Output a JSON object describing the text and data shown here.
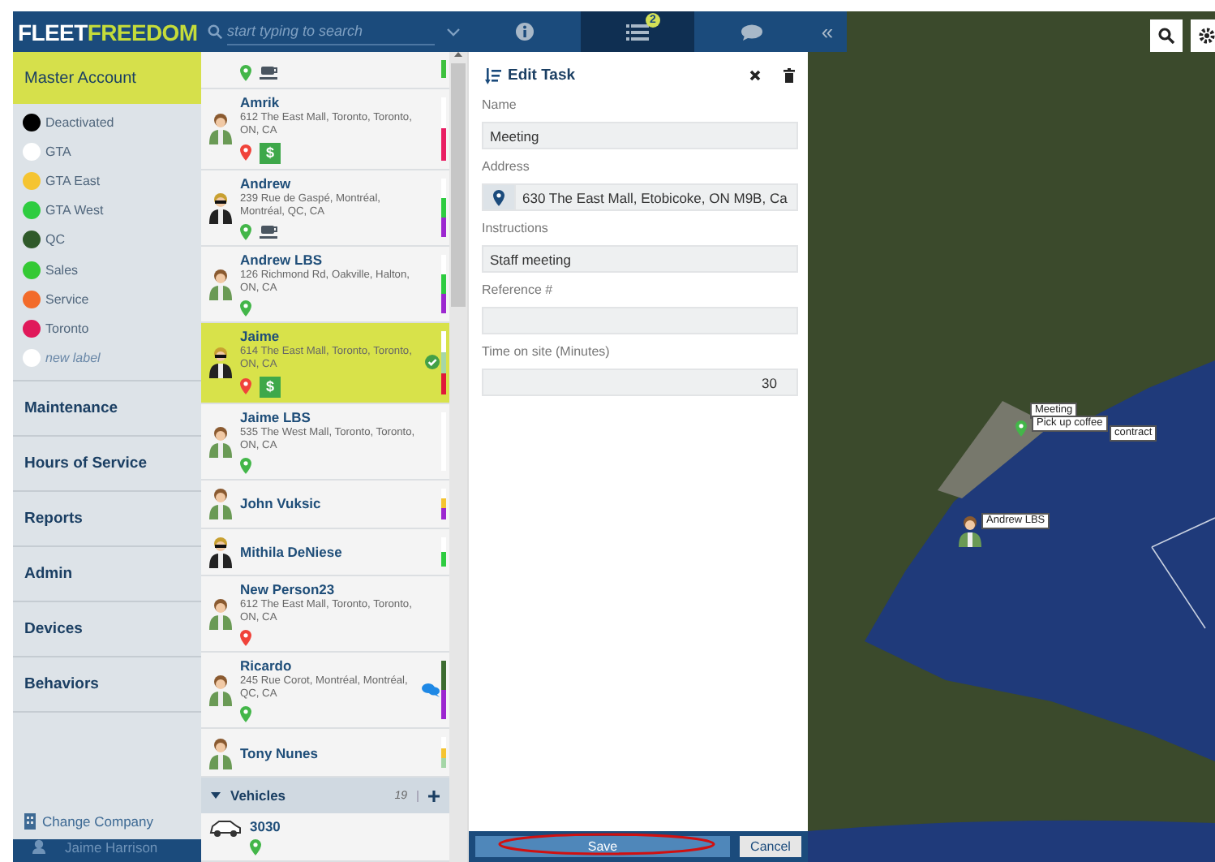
{
  "header": {
    "logo_parts": [
      "FLEET",
      "FREEDOM"
    ],
    "search": {
      "placeholder": "start typing to search"
    },
    "tabs": [
      {
        "kind": "info",
        "selected": false
      },
      {
        "kind": "tasks",
        "selected": true,
        "badge": "2"
      },
      {
        "kind": "chat",
        "selected": false
      }
    ],
    "collapse": "«"
  },
  "sidebar": {
    "account": {
      "label": "Master Account",
      "selected": true
    },
    "labels": [
      {
        "name": "Deactivated",
        "color": "#000000",
        "kind": "label"
      },
      {
        "name": "GTA",
        "color": "#ffffff",
        "kind": "label"
      },
      {
        "name": "GTA East",
        "color": "#f5c431",
        "kind": "label"
      },
      {
        "name": "GTA West",
        "color": "#2ecc40",
        "kind": "label"
      },
      {
        "name": "QC",
        "color": "#2f5a2a",
        "kind": "label"
      },
      {
        "name": "Sales",
        "color": "#34c934",
        "kind": "label"
      },
      {
        "name": "Service",
        "color": "#f26b2a",
        "kind": "label"
      },
      {
        "name": "Toronto",
        "color": "#e0195a",
        "kind": "label"
      },
      {
        "name": "new label",
        "color": "#ffffff",
        "kind": "new"
      }
    ],
    "menu": [
      "Maintenance",
      "Hours of Service",
      "Reports",
      "Admin",
      "Devices",
      "Behaviors"
    ],
    "change_company": "Change Company",
    "user": "Jaime Harrison"
  },
  "people": [
    {
      "kind": "partial",
      "pin": {
        "color": "#43b649"
      },
      "cup": true,
      "selected": false,
      "done": false,
      "chat": false,
      "tags": [
        {
          "color": "#3ec13e"
        }
      ]
    },
    {
      "kind": "person",
      "name": "Amrik",
      "address": "612 The East Mall, Toronto, Toronto, ON, CA",
      "pin": {
        "color": "#f0433a"
      },
      "cup": false,
      "payment": "$",
      "selected": false,
      "done": false,
      "chat": false,
      "tags": [
        {
          "color": "#ffffff"
        },
        {
          "color": "#e91e63"
        }
      ]
    },
    {
      "kind": "person",
      "name": "Andrew",
      "address": "239 Rue de Gaspé, Montréal, Montréal, QC, CA",
      "pin": {
        "color": "#43b649"
      },
      "cup": true,
      "selected": false,
      "done": false,
      "chat": false,
      "tags": [
        {
          "color": "#ffffff"
        },
        {
          "color": "#2ecc40"
        },
        {
          "color": "#9c27d0"
        }
      ]
    },
    {
      "kind": "person",
      "name": "Andrew LBS",
      "address": "126 Richmond Rd, Oakville, Halton, ON, CA",
      "pin": {
        "color": "#43b649"
      },
      "cup": false,
      "selected": false,
      "done": false,
      "chat": false,
      "tags": [
        {
          "color": "#ffffff"
        },
        {
          "color": "#2ecc40"
        },
        {
          "color": "#9c27d0"
        }
      ]
    },
    {
      "kind": "person",
      "name": "Jaime",
      "address": "614 The East Mall, Toronto, Toronto, ON, CA",
      "pin": {
        "color": "#f0433a"
      },
      "cup": false,
      "payment": "$",
      "selected": true,
      "done": true,
      "chat": false,
      "tags": [
        {
          "color": "#ffffff"
        },
        {
          "color": "#a5d6a7"
        },
        {
          "color": "#e0193a"
        }
      ]
    },
    {
      "kind": "person",
      "name": "Jaime LBS",
      "address": "535 The West Mall, Toronto, Toronto, ON, CA",
      "pin": {
        "color": "#43b649"
      },
      "cup": false,
      "selected": false,
      "done": false,
      "chat": false,
      "tags": [
        {
          "color": "#ffffff"
        }
      ]
    },
    {
      "kind": "person",
      "name": "John Vuksic",
      "cup": false,
      "selected": false,
      "done": false,
      "chat": false,
      "tags": [
        {
          "color": "#ffffff"
        },
        {
          "color": "#f5c431"
        },
        {
          "color": "#9c27d0"
        }
      ]
    },
    {
      "kind": "person",
      "name": "Mithila DeNiese",
      "cup": false,
      "selected": false,
      "done": false,
      "chat": false,
      "tags": [
        {
          "color": "#ffffff"
        },
        {
          "color": "#2ecc40"
        }
      ]
    },
    {
      "kind": "person",
      "name": "New Person23",
      "address": "612 The East Mall, Toronto, Toronto, ON, CA",
      "pin": {
        "color": "#f0433a"
      },
      "cup": false,
      "selected": false,
      "done": false,
      "chat": false
    },
    {
      "kind": "person",
      "name": "Ricardo",
      "address": "245 Rue Corot, Montréal, Montréal, QC, CA",
      "pin": {
        "color": "#43b649"
      },
      "cup": false,
      "selected": false,
      "done": false,
      "chat": true,
      "tags": [
        {
          "color": "#3c6b30"
        },
        {
          "color": "#9c27d0"
        }
      ]
    },
    {
      "kind": "person",
      "name": "Tony Nunes",
      "cup": false,
      "selected": false,
      "done": false,
      "chat": false,
      "tags": [
        {
          "color": "#ffffff"
        },
        {
          "color": "#f5c431"
        },
        {
          "color": "#a5d6a7"
        }
      ]
    }
  ],
  "vehicles": {
    "label": "Vehicles",
    "count": "19",
    "expanded": true,
    "items": [
      {
        "name": "3030",
        "pin": {
          "color": "#43b649"
        }
      }
    ]
  },
  "task_form": {
    "title": "Edit Task",
    "fields": [
      {
        "label": "Name",
        "value": "Meeting",
        "kind": "text"
      },
      {
        "label": "Address",
        "value": "630 The East Mall, Etobicoke, ON M9B, Ca",
        "kind": "address"
      },
      {
        "label": "Instructions",
        "value": "Staff meeting",
        "kind": "text"
      },
      {
        "label": "Reference #",
        "kind": "text"
      },
      {
        "label": "Time on site (Minutes)",
        "value": "30",
        "kind": "number"
      }
    ],
    "buttons": [
      {
        "label": "Save",
        "kind": "primary"
      },
      {
        "label": "Cancel",
        "kind": "secondary"
      }
    ]
  },
  "map": {
    "markers": [
      {
        "label": "Meeting",
        "kind": "task"
      },
      {
        "label": "Pick up coffee",
        "kind": "task"
      },
      {
        "label": "contract",
        "kind": "task"
      },
      {
        "label": "Andrew LBS",
        "kind": "person"
      }
    ]
  }
}
